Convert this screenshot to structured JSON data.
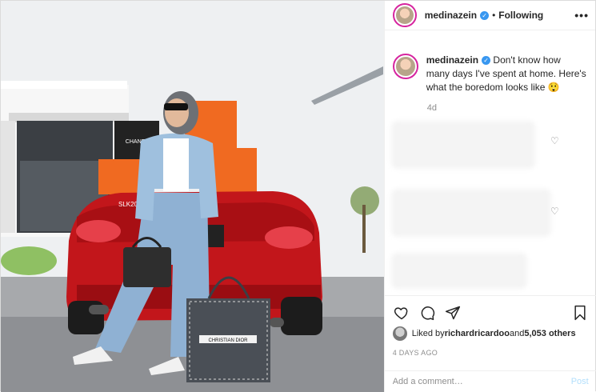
{
  "post": {
    "username": "medinazein",
    "follow_status": "Following",
    "separator": "•",
    "more_glyph": "•••",
    "verified_glyph": "✓",
    "caption": "Don't know how many days I've spent at home. Here's what the boredom looks like 😲",
    "time_ago": "4d",
    "likes_prefix": "Liked by ",
    "likes_user": "richardricardoo",
    "likes_joiner": " and ",
    "likes_count": "5,053 others",
    "date": "4 DAYS AGO",
    "comment_placeholder": "Add a comment…",
    "post_label": "Post",
    "heart_glyph": "♡"
  },
  "photo": {
    "car_plate": "SLK200",
    "box_label": "CHANEL",
    "bag_label": "CHRISTIAN DIOR"
  },
  "colors": {
    "accent_link": "#b2dffc",
    "verified_blue": "#3897f0",
    "car_red": "#c2161b",
    "box_orange": "#f06a21"
  }
}
